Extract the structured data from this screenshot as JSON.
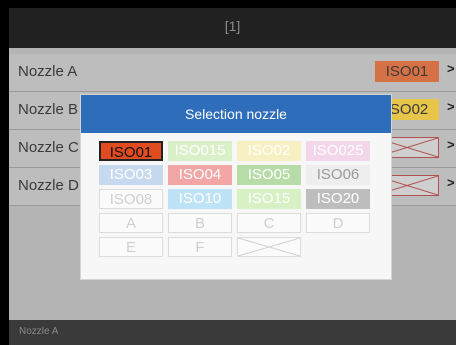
{
  "title": "[1]",
  "rows": [
    {
      "name": "Nozzle A",
      "chip": "ISO01",
      "kind": "orange"
    },
    {
      "name": "Nozzle B",
      "chip": "ISO02",
      "kind": "yellow"
    },
    {
      "name": "Nozzle C",
      "chip": "",
      "kind": "cross"
    },
    {
      "name": "Nozzle D",
      "chip": "",
      "kind": "cross"
    }
  ],
  "arrow": ">",
  "footer": "Nozzle A",
  "dialog": {
    "title": "Selection nozzle",
    "options": [
      {
        "label": "ISO01",
        "bg": "#e04b20",
        "selected": true
      },
      {
        "label": "ISO015",
        "bg": "#d9f0c8"
      },
      {
        "label": "ISO02",
        "bg": "#f6f0c2"
      },
      {
        "label": "ISO025",
        "bg": "#f4d6ea"
      },
      {
        "label": "ISO03",
        "bg": "#c6d9ef"
      },
      {
        "label": "ISO04",
        "bg": "#f3a6a6"
      },
      {
        "label": "ISO05",
        "bg": "#b7dca8"
      },
      {
        "label": "ISO06",
        "bg": "#eeeeee",
        "dark": true
      },
      {
        "label": "ISO08",
        "bg": "#fbfbfb",
        "plain": true
      },
      {
        "label": "ISO10",
        "bg": "#bfe3f6"
      },
      {
        "label": "ISO15",
        "bg": "#d7f0c4"
      },
      {
        "label": "ISO20",
        "bg": "#bdbdbd"
      },
      {
        "label": "A",
        "plain": true
      },
      {
        "label": "B",
        "plain": true
      },
      {
        "label": "C",
        "plain": true
      },
      {
        "label": "D",
        "plain": true
      },
      {
        "label": "E",
        "plain": true
      },
      {
        "label": "F",
        "plain": true
      },
      {
        "label": "",
        "cross": true
      }
    ]
  }
}
